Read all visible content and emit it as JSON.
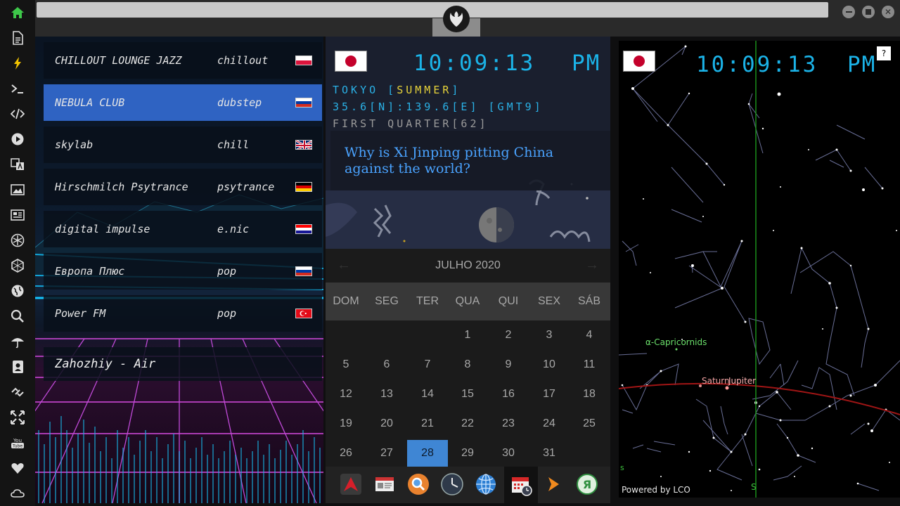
{
  "radio": {
    "stations": [
      {
        "name": "CHILLOUT LOUNGE JAZZ",
        "genre": "chillout",
        "flag": "pl"
      },
      {
        "name": "NEBULA CLUB",
        "genre": "dubstep",
        "flag": "ru"
      },
      {
        "name": "skylab",
        "genre": "chill",
        "flag": "gb"
      },
      {
        "name": "Hirschmilch Psytrance",
        "genre": "psytrance",
        "flag": "de"
      },
      {
        "name": "digital impulse",
        "genre": "e.nic",
        "flag": "hr"
      },
      {
        "name": "Европа Плюс",
        "genre": "pop",
        "flag": "ru"
      },
      {
        "name": "Power FM",
        "genre": "pop",
        "flag": "tr"
      }
    ],
    "active_station_index": 1,
    "now_playing": "Zahozhiy - Air"
  },
  "clock": {
    "time": "10:09:13",
    "ampm": "PM",
    "city_prefix": "TOKYO [",
    "season": "SUMMER",
    "city_suffix": "]",
    "coords": "35.6[N]:139.6[E] [GMT9]",
    "moon_phase": "FIRST QUARTER[62]",
    "news_headline": "Why is Xi Jinping pitting China against the world?"
  },
  "calendar": {
    "month_label": "JULHO 2020",
    "weekdays": [
      "DOM",
      "SEG",
      "TER",
      "QUA",
      "QUI",
      "SEX",
      "SÁB"
    ],
    "first_weekday_index": 3,
    "days_in_month": 31,
    "today": 28,
    "days": [
      "1",
      "2",
      "3",
      "4",
      "5",
      "6",
      "7",
      "8",
      "9",
      "10",
      "11",
      "12",
      "13",
      "14",
      "15",
      "16",
      "17",
      "18",
      "19",
      "20",
      "21",
      "22",
      "23",
      "24",
      "25",
      "26",
      "27",
      "28",
      "29",
      "30",
      "31"
    ]
  },
  "sky": {
    "time": "10:09:13",
    "ampm": "PM",
    "labels": {
      "meteor_shower": "α-Capricornids",
      "saturn": "Saturn",
      "jupiter": "Jupiter",
      "south_marker": "S",
      "south_edge": "s",
      "credit": "Powered by LCO"
    },
    "help": "?"
  },
  "colors": {
    "accent_cyan": "#1bb3e8",
    "season_yellow": "#e6d23a",
    "active_row": "#2f63c2",
    "today_cell": "#3f86d4",
    "ecliptic": "#a01515",
    "meridian": "#1a8f1a"
  },
  "rail_icons": [
    "home-icon",
    "document-icon",
    "lightning-icon",
    "terminal-icon",
    "code-icon",
    "play-icon",
    "translate-icon",
    "image-icon",
    "news-icon",
    "rebel-icon",
    "hexagon-icon",
    "globe-icon",
    "search-icon",
    "umbrella-icon",
    "contact-icon",
    "link-icon",
    "move-icon",
    "youtube-icon",
    "heart-icon",
    "cloud-icon"
  ],
  "dock_icons": [
    "app-launcher-icon",
    "news-app-icon",
    "search-app-icon",
    "clock-app-icon",
    "browser-icon",
    "calendar-app-icon",
    "media-play-icon",
    "yandex-icon"
  ]
}
